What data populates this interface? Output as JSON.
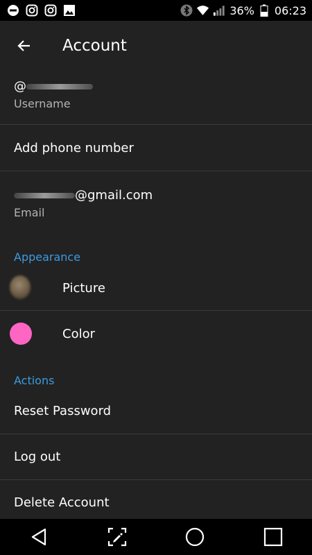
{
  "status_bar": {
    "battery_text": "36%",
    "time": "06:23",
    "left_icons": [
      "do-not-disturb-icon",
      "instagram-icon",
      "instagram-icon",
      "gallery-icon"
    ],
    "right_icons": [
      "bluetooth-icon",
      "wifi-icon",
      "signal-icon",
      "battery-icon"
    ]
  },
  "toolbar": {
    "title": "Account",
    "back_icon": "back-arrow-icon"
  },
  "profile": {
    "username_prefix": "@",
    "username_label": "Username",
    "phone_label": "Add phone number",
    "email_suffix": "@gmail.com",
    "email_label": "Email"
  },
  "appearance": {
    "header": "Appearance",
    "picture_label": "Picture",
    "color_label": "Color",
    "color_value": "#ff66c4"
  },
  "actions": {
    "header": "Actions",
    "reset_label": "Reset Password",
    "logout_label": "Log out",
    "delete_label": "Delete Account"
  },
  "nav": {
    "icons": [
      "back-triangle-icon",
      "screen-edit-icon",
      "home-circle-icon",
      "recents-square-icon"
    ]
  },
  "colors": {
    "background": "#222222",
    "accent": "#3d9be0",
    "secondary_text": "#b3b3b3"
  }
}
